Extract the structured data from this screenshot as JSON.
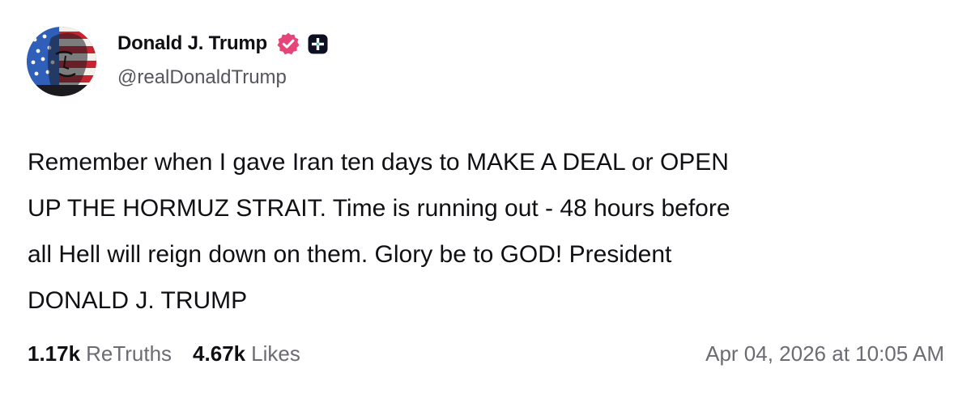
{
  "author": {
    "display_name": "Donald J. Trump",
    "handle": "@realDonaldTrump",
    "verified_icon": "verified-badge-icon",
    "plus_icon": "truth-plus-icon",
    "verified_color": "#e6457a"
  },
  "post": {
    "lines": [
      "Remember when I gave Iran ten days to MAKE A DEAL or OPEN",
      "UP THE HORMUZ STRAIT. Time is running out - 48 hours before",
      "all Hell will reign down on them. Glory be to GOD! President",
      "DONALD J. TRUMP"
    ]
  },
  "stats": {
    "retruths_count": "1.17k",
    "retruths_label": "ReTruths",
    "likes_count": "4.67k",
    "likes_label": "Likes",
    "timestamp": "Apr 04, 2026 at 10:05 AM"
  }
}
